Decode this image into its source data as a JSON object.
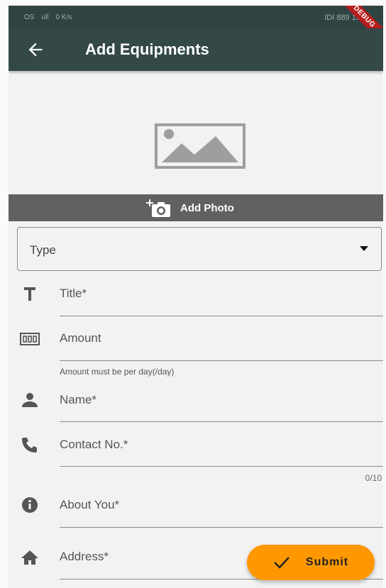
{
  "status_bar": {
    "network": "OS",
    "signal": "ull",
    "speed": "0 K/s",
    "right": "IDI 889 13"
  },
  "debug_banner": "DEBUG",
  "app_bar": {
    "title": "Add Equipments",
    "back_icon": "arrow-back-icon"
  },
  "image_placeholder": {
    "icon": "image-icon"
  },
  "add_photo": {
    "label": "Add Photo",
    "icon": "add-a-photo-icon"
  },
  "type_dropdown": {
    "label": "Type",
    "icon": "arrow-drop-down-icon"
  },
  "fields": {
    "title": {
      "label": "Title*",
      "icon": "text-icon"
    },
    "amount": {
      "label": "Amount",
      "icon": "money-icon",
      "helper": "Amount must be per day(/day)"
    },
    "name": {
      "label": "Name*",
      "icon": "person-icon"
    },
    "contact": {
      "label": "Contact No.*",
      "icon": "phone-icon",
      "counter": "0/10"
    },
    "about": {
      "label": "About You*",
      "icon": "info-icon"
    },
    "address": {
      "label": "Address*",
      "icon": "home-icon"
    }
  },
  "submit": {
    "label": "Submit",
    "icon": "check-icon"
  },
  "colors": {
    "app_bar": "#344848",
    "submit": "#ff9800",
    "photo_bar": "#616161"
  }
}
